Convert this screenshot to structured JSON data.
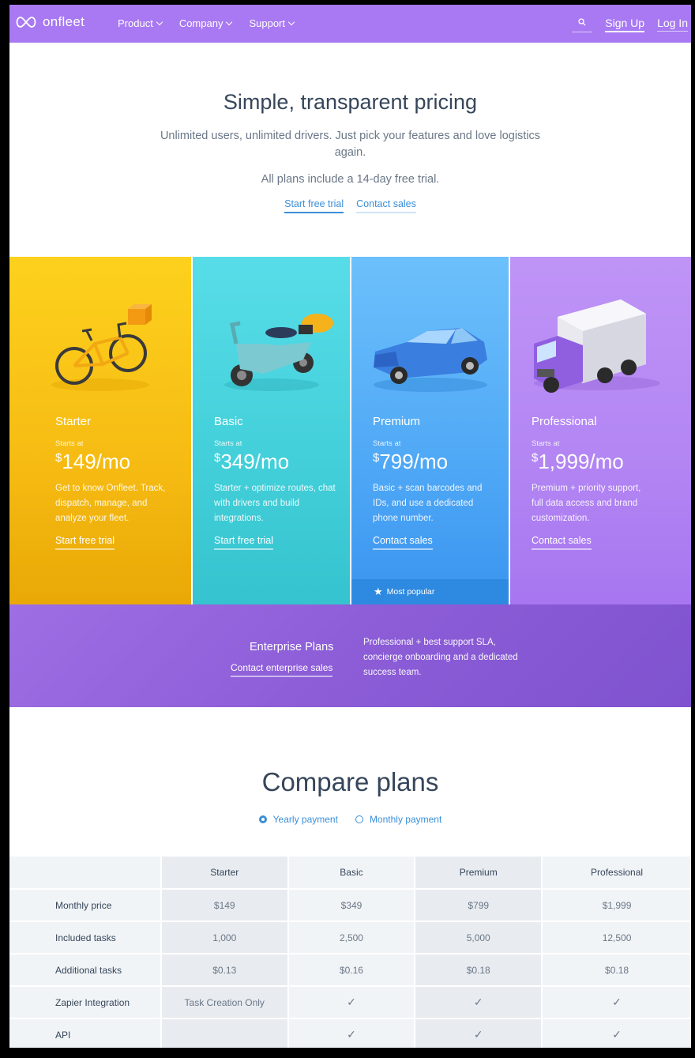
{
  "nav": {
    "logo_text": "onfleet",
    "menu": [
      {
        "label": "Product"
      },
      {
        "label": "Company"
      },
      {
        "label": "Support"
      }
    ],
    "sign_up": "Sign Up",
    "log_in": "Log In"
  },
  "hero": {
    "title": "Simple, transparent pricing",
    "subtitle": "Unlimited users, unlimited drivers. Just pick your features and love logistics again.",
    "trial_note": "All plans include a 14-day free trial.",
    "start_trial": "Start free trial",
    "contact_sales": "Contact sales"
  },
  "plans": [
    {
      "name": "Starter",
      "starts_at": "Starts at",
      "currency": "$",
      "price": "149/mo",
      "description": "Get to know Onfleet. Track, dispatch, manage, and analyze your fleet.",
      "cta": "Start free trial"
    },
    {
      "name": "Basic",
      "starts_at": "Starts at",
      "currency": "$",
      "price": "349/mo",
      "description": "Starter + optimize routes, chat with drivers and build integrations.",
      "cta": "Start free trial"
    },
    {
      "name": "Premium",
      "starts_at": "Starts at",
      "currency": "$",
      "price": "799/mo",
      "description": "Basic + scan barcodes and IDs, and use a dedicated phone number.",
      "cta": "Contact sales",
      "badge": "Most popular"
    },
    {
      "name": "Professional",
      "starts_at": "Starts at",
      "currency": "$",
      "price": "1,999/mo",
      "description": "Premium + priority support, full data access and brand customization.",
      "cta": "Contact sales"
    }
  ],
  "enterprise": {
    "title": "Enterprise Plans",
    "cta": "Contact enterprise sales",
    "description": "Professional + best support SLA, concierge onboarding and a dedicated success team."
  },
  "compare": {
    "title": "Compare plans",
    "yearly": "Yearly payment",
    "monthly": "Monthly payment",
    "columns": [
      "Starter",
      "Basic",
      "Premium",
      "Professional"
    ],
    "rows": [
      {
        "label": "Monthly price",
        "values": [
          "$149",
          "$349",
          "$799",
          "$1,999"
        ]
      },
      {
        "label": "Included tasks",
        "values": [
          "1,000",
          "2,500",
          "5,000",
          "12,500"
        ]
      },
      {
        "label": "Additional tasks",
        "values": [
          "$0.13",
          "$0.16",
          "$0.18",
          "$0.18"
        ]
      },
      {
        "label": "Zapier Integration",
        "values": [
          "Task Creation Only",
          "✓",
          "✓",
          "✓"
        ]
      },
      {
        "label": "API",
        "values": [
          "",
          "✓",
          "✓",
          "✓"
        ]
      }
    ]
  },
  "colors": {
    "nav": "#a879f2",
    "starter": "#fbc91a",
    "basic": "#4ad5e0",
    "premium": "#56abf7",
    "professional": "#b68af4",
    "enterprise": "#8d5ed8",
    "link": "#3b8fd9"
  }
}
